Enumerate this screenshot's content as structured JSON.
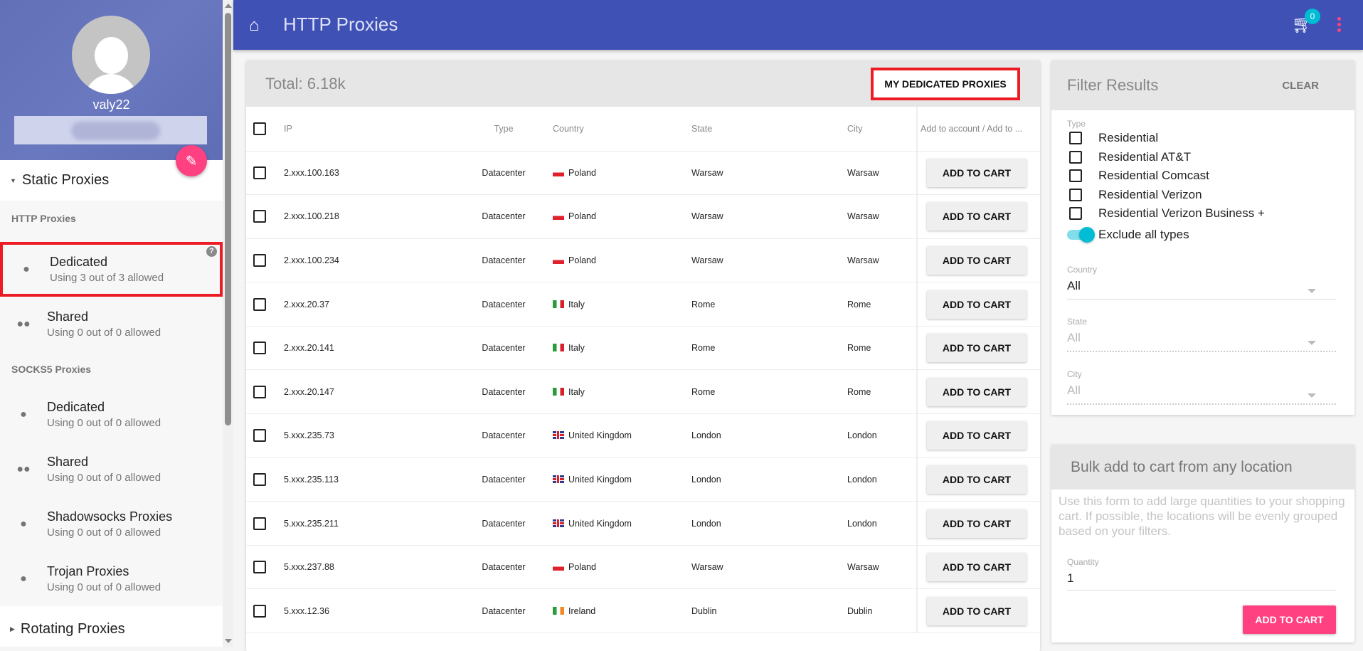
{
  "sidebar": {
    "username": "valy22",
    "static_section": "Static Proxies",
    "http_heading": "HTTP Proxies",
    "socks_heading": "SOCKS5 Proxies",
    "rotating_section": "Rotating Proxies",
    "http_items": [
      {
        "label": "Dedicated",
        "usage": "Using 3 out of 3 allowed"
      },
      {
        "label": "Shared",
        "usage": "Using 0 out of 0 allowed"
      }
    ],
    "socks_items": [
      {
        "label": "Dedicated",
        "usage": "Using 0 out of 0 allowed"
      },
      {
        "label": "Shared",
        "usage": "Using 0 out of 0 allowed"
      },
      {
        "label": "Shadowsocks Proxies",
        "usage": "Using 0 out of 0 allowed"
      },
      {
        "label": "Trojan Proxies",
        "usage": "Using 0 out of 0 allowed"
      }
    ]
  },
  "topbar": {
    "title": "HTTP Proxies",
    "cart_count": "0"
  },
  "table": {
    "total": "Total: 6.18k",
    "my_dedicated_label": "MY DEDICATED PROXIES",
    "headers": {
      "ip": "IP",
      "type": "Type",
      "country": "Country",
      "state": "State",
      "city": "City",
      "action": "Add to account / Add to ..."
    },
    "add_label": "ADD TO CART",
    "rows": [
      {
        "ip": "2.xxx.100.163",
        "type": "Datacenter",
        "flag": "pl",
        "country": "Poland",
        "state": "Warsaw",
        "city": "Warsaw"
      },
      {
        "ip": "2.xxx.100.218",
        "type": "Datacenter",
        "flag": "pl",
        "country": "Poland",
        "state": "Warsaw",
        "city": "Warsaw"
      },
      {
        "ip": "2.xxx.100.234",
        "type": "Datacenter",
        "flag": "pl",
        "country": "Poland",
        "state": "Warsaw",
        "city": "Warsaw"
      },
      {
        "ip": "2.xxx.20.37",
        "type": "Datacenter",
        "flag": "it",
        "country": "Italy",
        "state": "Rome",
        "city": "Rome"
      },
      {
        "ip": "2.xxx.20.141",
        "type": "Datacenter",
        "flag": "it",
        "country": "Italy",
        "state": "Rome",
        "city": "Rome"
      },
      {
        "ip": "2.xxx.20.147",
        "type": "Datacenter",
        "flag": "it",
        "country": "Italy",
        "state": "Rome",
        "city": "Rome"
      },
      {
        "ip": "5.xxx.235.73",
        "type": "Datacenter",
        "flag": "gb",
        "country": "United Kingdom",
        "state": "London",
        "city": "London"
      },
      {
        "ip": "5.xxx.235.113",
        "type": "Datacenter",
        "flag": "gb",
        "country": "United Kingdom",
        "state": "London",
        "city": "London"
      },
      {
        "ip": "5.xxx.235.211",
        "type": "Datacenter",
        "flag": "gb",
        "country": "United Kingdom",
        "state": "London",
        "city": "London"
      },
      {
        "ip": "5.xxx.237.88",
        "type": "Datacenter",
        "flag": "pl",
        "country": "Poland",
        "state": "Warsaw",
        "city": "Warsaw"
      },
      {
        "ip": "5.xxx.12.36",
        "type": "Datacenter",
        "flag": "ie",
        "country": "Ireland",
        "state": "Dublin",
        "city": "Dublin"
      }
    ]
  },
  "filter": {
    "title": "Filter Results",
    "clear_label": "CLEAR",
    "type_label": "Type",
    "types": [
      "Residential",
      "Residential AT&T",
      "Residential Comcast",
      "Residential Verizon",
      "Residential Verizon Business +"
    ],
    "exclude_label": "Exclude all types",
    "exclude_on": true,
    "country_label": "Country",
    "country_value": "All",
    "state_label": "State",
    "state_value": "All",
    "city_label": "City",
    "city_value": "All"
  },
  "bulk": {
    "title": "Bulk add to cart from any location",
    "description": "Use this form to add large quantities to your shopping cart. If possible, the locations will be evenly grouped based on your filters.",
    "quantity_label": "Quantity",
    "quantity_value": "1",
    "add_label": "ADD TO CART"
  }
}
